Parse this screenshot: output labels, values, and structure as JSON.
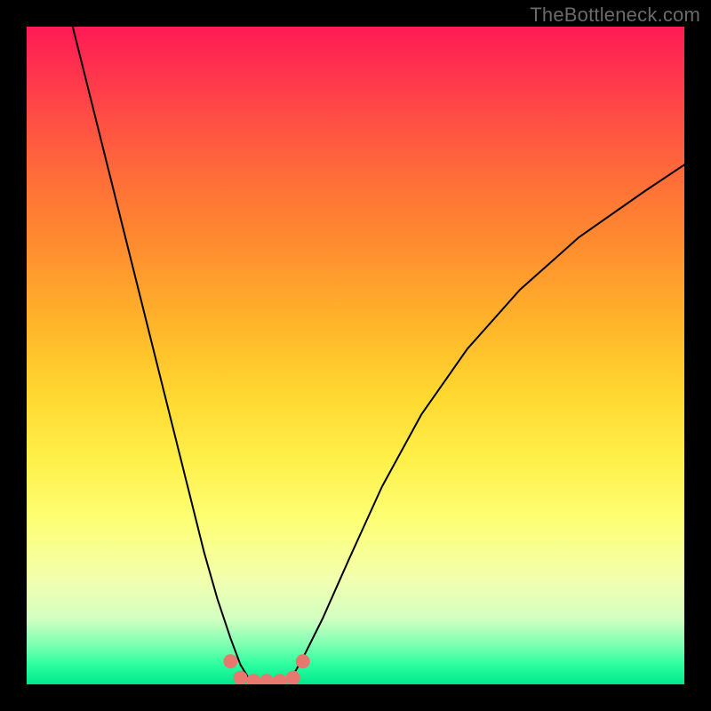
{
  "watermark": "TheBottleneck.com",
  "chart_data": {
    "type": "line",
    "title": "",
    "xlabel": "",
    "ylabel": "",
    "xlim": [
      0,
      100
    ],
    "ylim": [
      0,
      100
    ],
    "background_gradient": {
      "top_color": "#ff1a55",
      "mid_color": "#ffe54a",
      "bottom_color": "#00e88b"
    },
    "series": [
      {
        "name": "left-curve",
        "type": "line",
        "color": "#000000",
        "stroke_width": 2,
        "x": [
          7,
          10,
          13,
          16,
          19,
          22,
          25,
          27,
          29,
          31,
          32.5,
          34
        ],
        "y": [
          100,
          88,
          76,
          64,
          52,
          40,
          28,
          20,
          13,
          7,
          3,
          0.5
        ]
      },
      {
        "name": "right-curve",
        "type": "line",
        "color": "#000000",
        "stroke_width": 2,
        "x": [
          40,
          42,
          45,
          49,
          54,
          60,
          67,
          75,
          84,
          94,
          100
        ],
        "y": [
          0.5,
          4,
          10,
          19,
          30,
          41,
          51,
          60,
          68,
          75,
          79
        ]
      },
      {
        "name": "bottom-marker-band",
        "type": "marker",
        "color": "#e6786f",
        "marker_size": 16,
        "x": [
          31,
          32.5,
          34.5,
          36.5,
          38.5,
          40.5,
          42
        ],
        "y": [
          3.5,
          1,
          0.5,
          0.5,
          0.5,
          1,
          3.5
        ]
      }
    ]
  }
}
